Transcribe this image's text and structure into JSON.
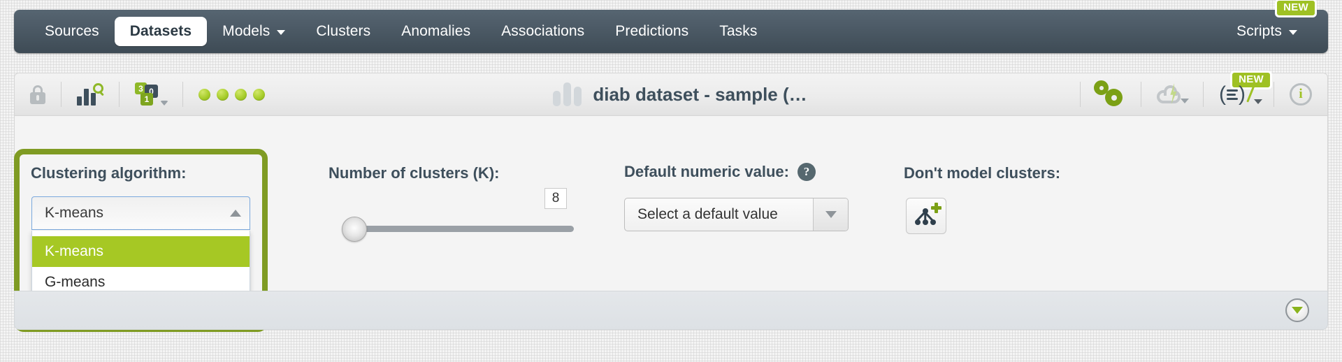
{
  "nav": {
    "items": [
      {
        "label": "Sources",
        "active": false,
        "dropdown": false
      },
      {
        "label": "Datasets",
        "active": true,
        "dropdown": false
      },
      {
        "label": "Models",
        "active": false,
        "dropdown": true
      },
      {
        "label": "Clusters",
        "active": false,
        "dropdown": false
      },
      {
        "label": "Anomalies",
        "active": false,
        "dropdown": false
      },
      {
        "label": "Associations",
        "active": false,
        "dropdown": false
      },
      {
        "label": "Predictions",
        "active": false,
        "dropdown": false
      },
      {
        "label": "Tasks",
        "active": false,
        "dropdown": false
      }
    ],
    "scripts_label": "Scripts",
    "scripts_badge": "NEW"
  },
  "toolbar": {
    "lock_icon": "lock-icon",
    "chart_search_icon": "chart-search-icon",
    "fields_icon": "field-types-icon",
    "status_dots": 4,
    "title": "diab dataset - sample (…",
    "configure_icon": "gears-icon",
    "cloud_icon": "cloud-bolt-icon",
    "script_icon": "equation-icon",
    "script_badge": "NEW",
    "info_icon": "info-icon"
  },
  "config": {
    "algorithm": {
      "label": "Clustering algorithm:",
      "selected": "K-means",
      "options": [
        {
          "label": "K-means",
          "selected": true
        },
        {
          "label": "G-means",
          "selected": false
        }
      ]
    },
    "clusters": {
      "label": "Number of clusters (K):",
      "value": "8",
      "slider_position_pct": 0
    },
    "default_numeric": {
      "label": "Default numeric value:",
      "help_icon": "help-icon",
      "placeholder": "Select a default value",
      "value": "Select a default value"
    },
    "dont_model": {
      "label": "Don't model clusters:",
      "button_icon": "add-cluster-tree-icon"
    }
  },
  "bottom": {
    "expand_icon": "chevron-down-circle-icon"
  },
  "colors": {
    "navbar": "#4e5c68",
    "accent_green": "#a6c824",
    "highlight_green": "#7f9b23",
    "dark_text": "#3e4f5c"
  }
}
